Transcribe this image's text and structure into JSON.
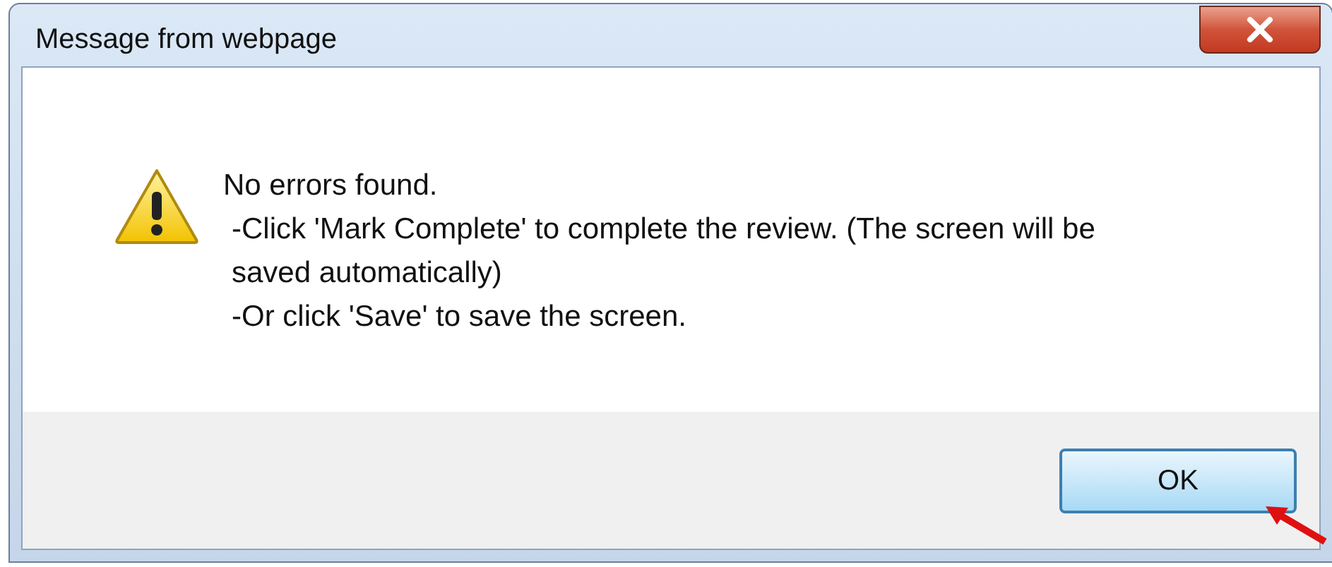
{
  "window": {
    "title": "Message from webpage"
  },
  "message": {
    "lines": [
      "No errors found.",
      "-Click 'Mark Complete' to complete the review. (The screen will be saved automatically)",
      "-Or click 'Save' to save the screen."
    ]
  },
  "buttons": [
    {
      "label": "OK",
      "selected": true
    }
  ]
}
